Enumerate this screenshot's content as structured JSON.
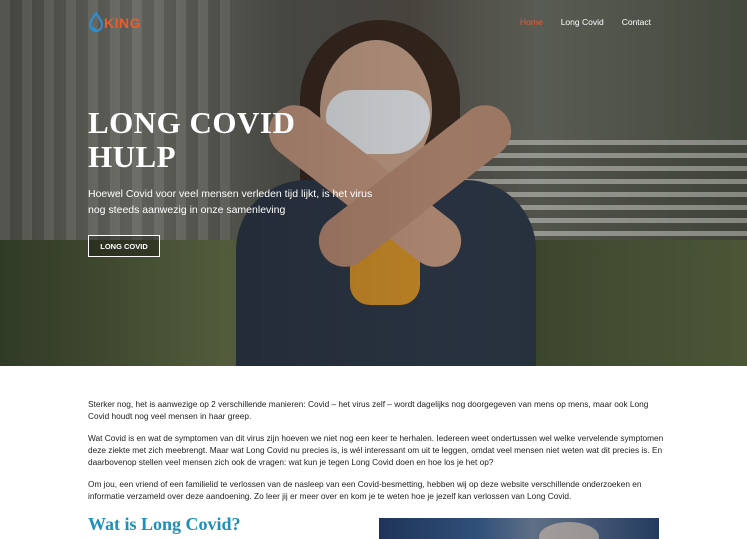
{
  "header": {
    "logo_text": "KING",
    "nav": [
      {
        "label": "Home",
        "active": true
      },
      {
        "label": "Long Covid",
        "active": false
      },
      {
        "label": "Contact",
        "active": false
      }
    ]
  },
  "hero": {
    "title_line1": "LONG COVID",
    "title_line2": "HULP",
    "subtitle": "Hoewel Covid voor veel mensen verleden tijd lijkt, is het virus nog steeds aanwezig in onze samenleving",
    "button_label": "LONG COVID"
  },
  "content": {
    "paragraphs": [
      "Sterker nog, het is aanwezige op 2 verschillende manieren: Covid – het virus zelf – wordt dagelijks nog doorgegeven van mens op mens, maar ook Long Covid houdt nog veel mensen in haar greep.",
      "Wat Covid is en wat de symptomen van dit virus zijn hoeven we niet nog een keer te herhalen. Iedereen weet ondertussen wel welke vervelende symptomen deze ziekte met zich meebrengt. Maar wat Long Covid nu precies is, is wél interessant om uit te leggen, omdat veel mensen niet weten wat dit precies is. En daarbovenop stellen veel mensen zich ook de vragen: wat kun je tegen Long Covid doen en hoe los je het op?",
      "Om jou, een vriend of een familielid te verlossen van de nasleep van een Covid-besmetting, hebben wij op deze website verschillende onderzoeken en informatie verzameld over deze aandoening. Zo leer jij er meer over en kom je te weten hoe je jezelf kan verlossen van Long Covid."
    ],
    "section_title": "Wat is Long Covid?"
  },
  "colors": {
    "accent": "#f05a28",
    "heading_blue": "#1e8fb8"
  }
}
